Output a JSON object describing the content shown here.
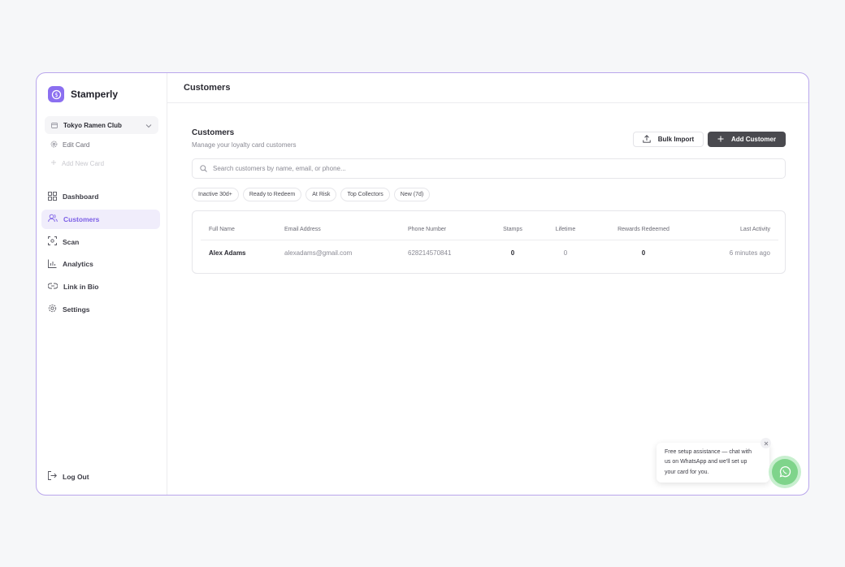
{
  "brand": {
    "name": "Stamperly",
    "icon": "stamp-logo-icon",
    "accent": "#8b6ff0"
  },
  "sidebar": {
    "card_select": {
      "label": "Tokyo Ramen Club",
      "icon": "card-icon"
    },
    "edit_card": {
      "label": "Edit Card",
      "icon": "gear-icon"
    },
    "add_new_card": {
      "label": "Add New Card",
      "icon": "plus-icon"
    },
    "items": [
      {
        "label": "Dashboard",
        "icon": "grid-icon",
        "active": false
      },
      {
        "label": "Customers",
        "icon": "users-icon",
        "active": true
      },
      {
        "label": "Scan",
        "icon": "scan-icon",
        "active": false
      },
      {
        "label": "Analytics",
        "icon": "bar-chart-icon",
        "active": false
      },
      {
        "label": "Link in Bio",
        "icon": "link-icon",
        "active": false
      },
      {
        "label": "Settings",
        "icon": "gear-icon",
        "active": false
      }
    ],
    "logout": {
      "label": "Log Out",
      "icon": "logout-icon"
    }
  },
  "header": {
    "title": "Customers"
  },
  "main": {
    "title": "Customers",
    "subtitle": "Manage your loyalty card customers",
    "bulk_import_label": "Bulk Import",
    "add_customer_label": "Add Customer",
    "search": {
      "placeholder": "Search customers by name, email, or phone...",
      "value": ""
    },
    "filters": [
      "Inactive 30d+",
      "Ready to Redeem",
      "At Risk",
      "Top Collectors",
      "New (7d)"
    ],
    "table": {
      "columns": [
        "Full Name",
        "Email Address",
        "Phone Number",
        "Stamps",
        "Lifetime",
        "Rewards Redeemed",
        "Last Activity"
      ],
      "rows": [
        {
          "full_name": "Alex Adams",
          "email": "alexadams@gmail.com",
          "phone": "628214570841",
          "stamps": "0",
          "lifetime": "0",
          "rewards_redeemed": "0",
          "last_activity": "6 minutes ago"
        }
      ]
    }
  },
  "chat_widget": {
    "message": "Free setup assistance — chat with us on WhatsApp and we'll set up your card for you.",
    "close_icon": "close-icon",
    "button_icon": "whatsapp-icon",
    "color": "#7fd48b"
  }
}
